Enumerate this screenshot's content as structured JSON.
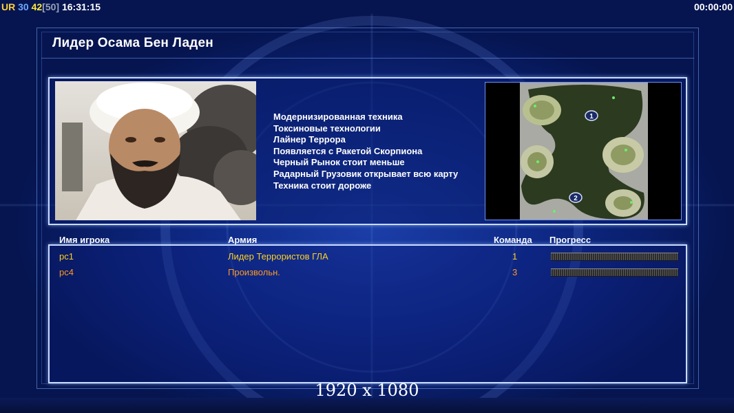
{
  "hud": {
    "ur": "UR",
    "val1": "30",
    "val2": "42",
    "val3": "[50]",
    "clock": "16:31:15",
    "timer": "00:00:00"
  },
  "title": "Лидер Осама Бен Ладен",
  "features": [
    "Модернизированная техника",
    "Токсиновые технологии",
    "Лайнер Террора",
    "Появляется с Ракетой Скорпиона",
    "Черный Рынок стоит меньше",
    "Радарный Грузовик открывает всю карту",
    "Техника стоит дороже"
  ],
  "minimap": {
    "start_positions": [
      "1",
      "2"
    ]
  },
  "columns": {
    "player": "Имя игрока",
    "army": "Армия",
    "team": "Команда",
    "progress": "Прогресс"
  },
  "players": [
    {
      "name": "pc1",
      "army": "Лидер Террористов ГЛА",
      "team": "1",
      "color": "#ffd21e",
      "progress": 0
    },
    {
      "name": "pc4",
      "army": "Произвольн.",
      "team": "3",
      "color": "#ff9a1e",
      "progress": 0
    }
  ],
  "resolution_label": "1920 x 1080",
  "colors": {
    "panel_border": "#c9dcff",
    "background": "#0f2a88"
  }
}
